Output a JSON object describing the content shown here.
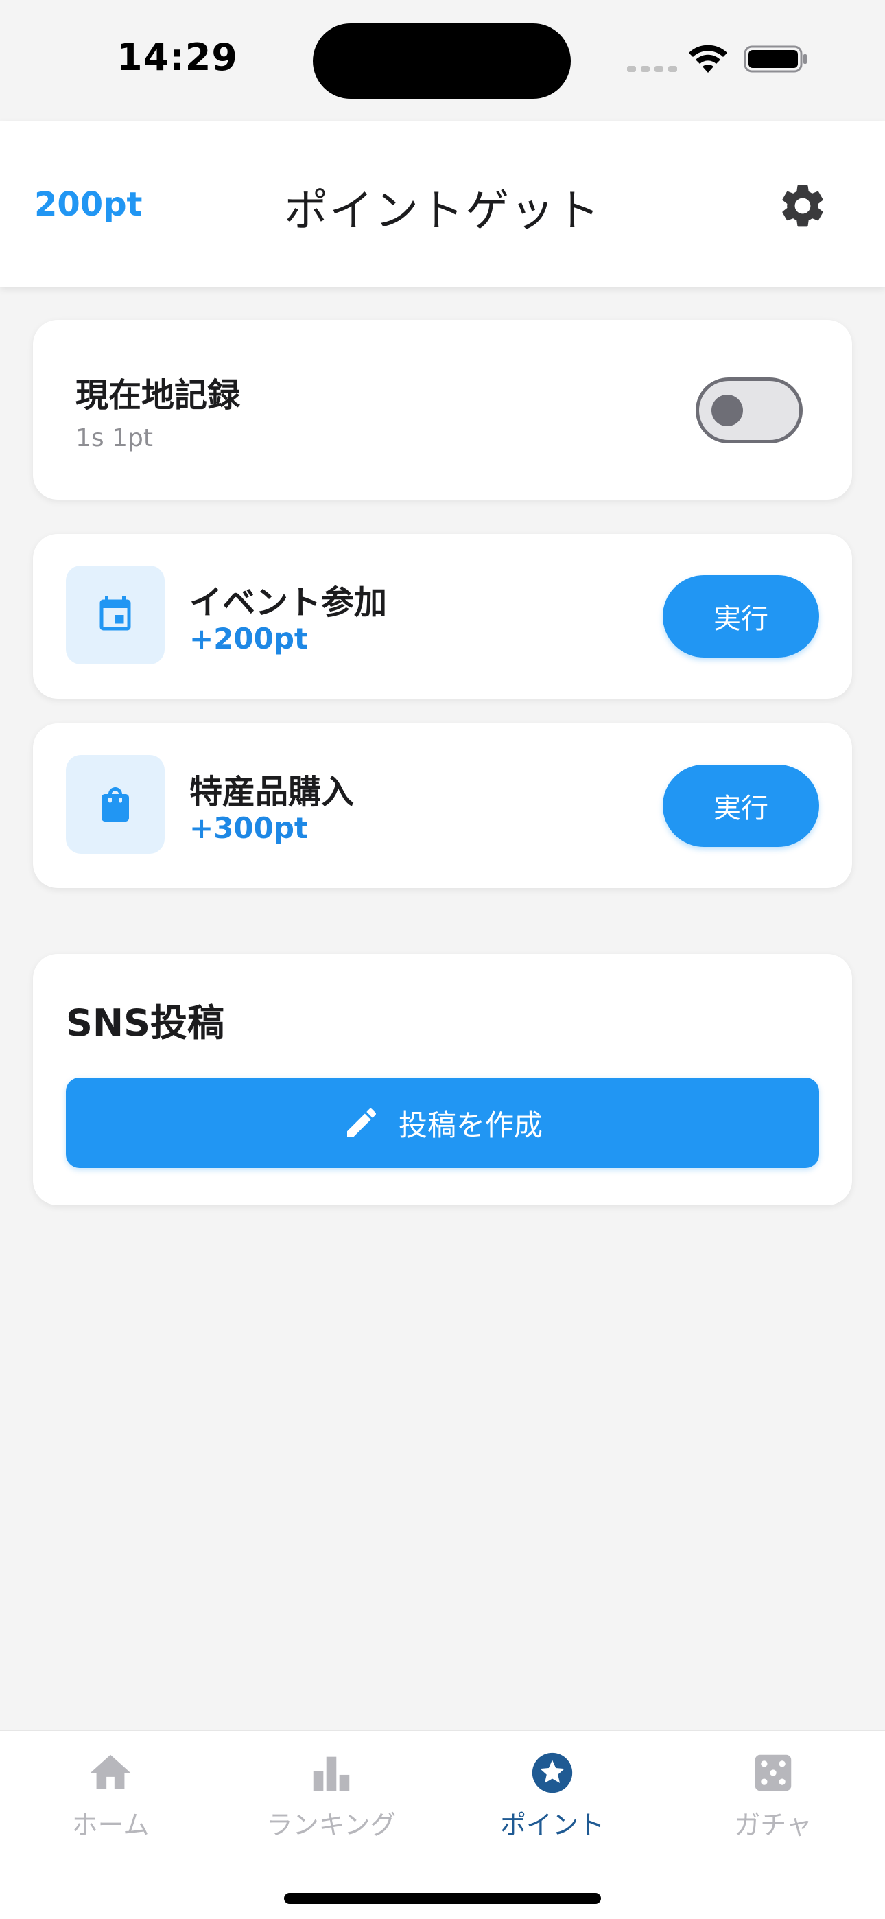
{
  "status_bar": {
    "time": "14:29"
  },
  "header": {
    "points": "200pt",
    "title": "ポイントゲット",
    "settings_icon": "gear-icon"
  },
  "location_card": {
    "title": "現在地記録",
    "subtitle": "1s 1pt",
    "toggle_on": false
  },
  "tasks": [
    {
      "title": "イベント参加",
      "points": "+200pt",
      "icon": "calendar-icon",
      "button_label": "実行"
    },
    {
      "title": "特産品購入",
      "points": "+300pt",
      "icon": "shopping-bag-icon",
      "button_label": "実行"
    }
  ],
  "sns": {
    "title": "SNS投稿",
    "button_label": "投稿を作成",
    "button_icon": "pencil-icon"
  },
  "nav": {
    "items": [
      {
        "label": "ホーム",
        "icon": "home-icon",
        "active": false
      },
      {
        "label": "ランキング",
        "icon": "bar-chart-icon",
        "active": false
      },
      {
        "label": "ポイント",
        "icon": "star-circle-icon",
        "active": true
      },
      {
        "label": "ガチャ",
        "icon": "dice-icon",
        "active": false
      }
    ]
  },
  "colors": {
    "accent": "#2196f3",
    "active_nav": "#1f5a93",
    "inactive_nav": "#b7b7bc",
    "background": "#f4f4f4"
  }
}
